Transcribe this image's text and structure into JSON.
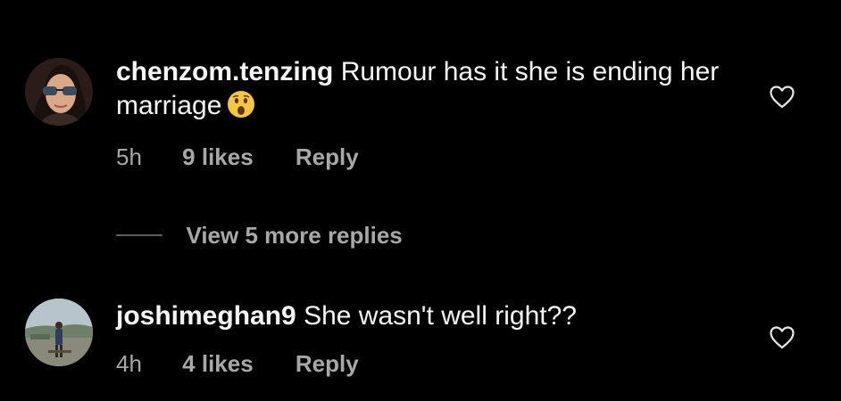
{
  "comments": [
    {
      "username": "chenzom.tenzing",
      "text": "Rumour has it she is ending her marriage",
      "emoji": "astonished-face",
      "time": "5h",
      "likes": "9 likes",
      "reply_label": "Reply"
    },
    {
      "username": "joshimeghan9",
      "text": "She wasn't well right??",
      "time": "4h",
      "likes": "4 likes",
      "reply_label": "Reply"
    }
  ],
  "replies": {
    "view_more_label": "View 5 more replies"
  },
  "colors": {
    "background": "#000000",
    "text": "#f5f5f5",
    "muted": "#a8a8a8"
  }
}
